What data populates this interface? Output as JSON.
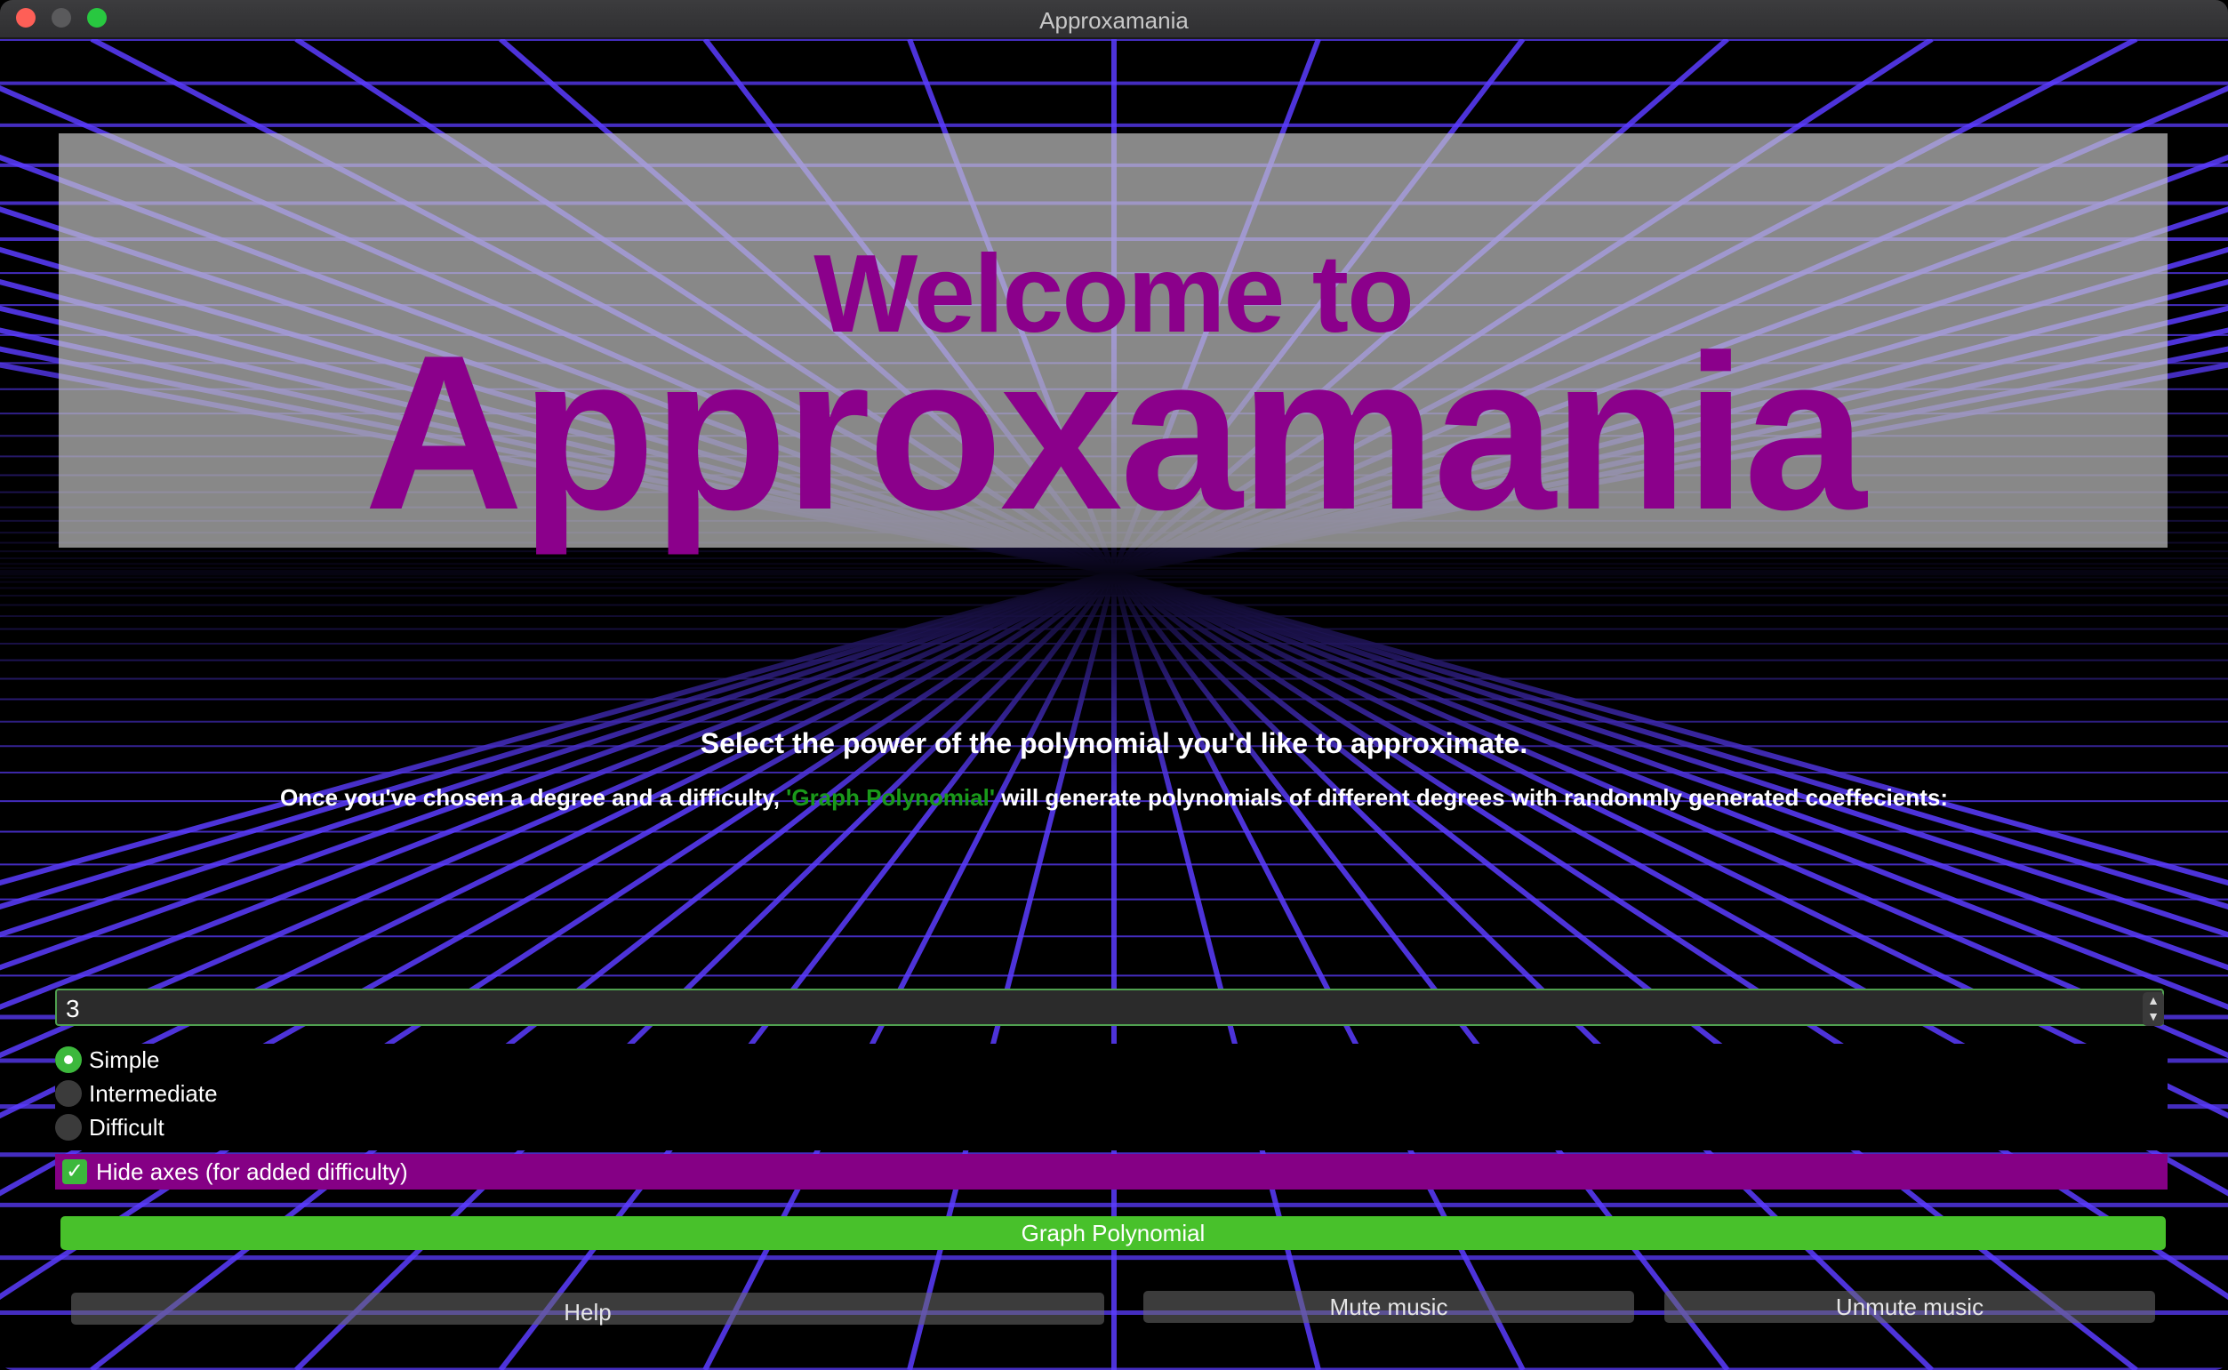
{
  "window": {
    "title": "Approxamania"
  },
  "banner": {
    "line1": "Welcome to",
    "line2": "Approxamania"
  },
  "instructions": {
    "heading": "Select the power of the polynomial you'd like to approximate.",
    "desc_before": "Once you've chosen a degree and a difficulty, ",
    "desc_highlight": "'Graph Polynomial'",
    "desc_after": " will generate polynomials of different degrees with randonmly generated coeffecients:"
  },
  "degree": {
    "value": "3"
  },
  "difficulty": {
    "options": [
      "Simple",
      "Intermediate",
      "Difficult"
    ],
    "selected": "Simple"
  },
  "hide_axes": {
    "label": "Hide axes (for added difficulty)",
    "checked": true
  },
  "buttons": {
    "graph": "Graph Polynomial",
    "help": "Help",
    "mute": "Mute music",
    "unmute": "Unmute music"
  },
  "colors": {
    "title_purple": "#8b008b",
    "grid": "#5b3cff",
    "accent_green": "#48c12b",
    "checkbox_row": "#850085"
  }
}
